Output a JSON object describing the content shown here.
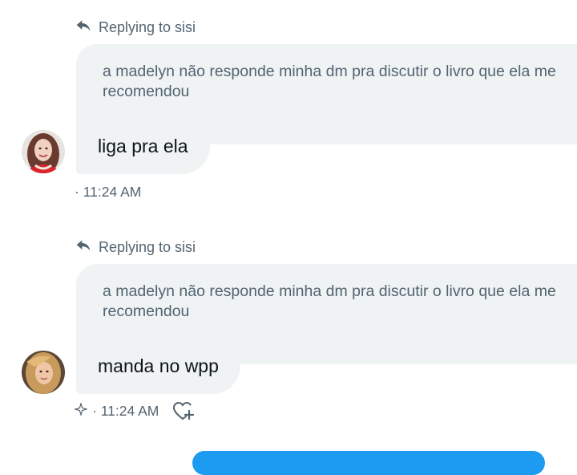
{
  "colors": {
    "bubble_bg": "#eff3f4",
    "secondary_text": "#536471",
    "primary_text": "#0f1419",
    "accent": "#1d9bf0"
  },
  "messages": [
    {
      "reply_label": "Replying to sisi",
      "quoted_line1": "a madelyn não responde minha dm pra discutir o livro que ela me",
      "quoted_line2": "recomendou",
      "text": "liga pra ela",
      "time": "· 11:24 AM",
      "avatar_icon": "avatar-red-hair"
    },
    {
      "reply_label": "Replying to sisi",
      "quoted_line1": "a madelyn não responde minha dm pra discutir o livro que ela me",
      "quoted_line2": "recomendou",
      "text": "manda no wpp",
      "time": "· 11:24 AM",
      "avatar_icon": "avatar-blonde-hair"
    }
  ]
}
